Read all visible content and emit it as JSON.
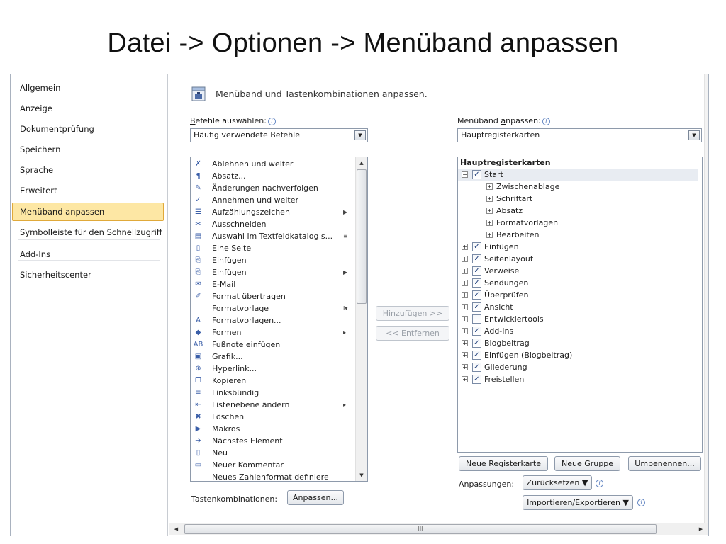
{
  "slide": {
    "title": "Datei -> Optionen -> Menüband anpassen"
  },
  "nav": {
    "items": [
      {
        "label": "Allgemein",
        "name": "nav-item-allgemein",
        "active": false
      },
      {
        "label": "Anzeige",
        "name": "nav-item-anzeige",
        "active": false
      },
      {
        "label": "Dokumentprüfung",
        "name": "nav-item-dokumentpruefung",
        "active": false
      },
      {
        "label": "Speichern",
        "name": "nav-item-speichern",
        "active": false
      },
      {
        "label": "Sprache",
        "name": "nav-item-sprache",
        "active": false
      },
      {
        "label": "Erweitert",
        "name": "nav-item-erweitert",
        "active": false
      },
      {
        "label": "Menüband anpassen",
        "name": "nav-item-menueband-anpassen",
        "active": true
      },
      {
        "label": "Symbolleiste für den Schnellzugriff",
        "name": "nav-item-schnellzugriff",
        "active": false
      },
      {
        "label": "Add-Ins",
        "name": "nav-item-add-ins",
        "active": false
      },
      {
        "label": "Sicherheitscenter",
        "name": "nav-item-sicherheitscenter",
        "active": false
      }
    ]
  },
  "content": {
    "header": "Menüband und Tastenkombinationen anpassen.",
    "commands": {
      "label_pre": "",
      "label_key": "B",
      "label_post": "efehle auswählen:",
      "selected": "Häufig verwendete Befehle",
      "items": [
        {
          "label": "Ablehnen und weiter",
          "icon": "reject-icon",
          "glyph": "✗",
          "sub": ""
        },
        {
          "label": "Absatz...",
          "icon": "paragraph-icon",
          "glyph": "¶",
          "sub": ""
        },
        {
          "label": "Änderungen nachverfolgen",
          "icon": "track-changes-icon",
          "glyph": "✎",
          "sub": ""
        },
        {
          "label": "Annehmen und weiter",
          "icon": "accept-icon",
          "glyph": "✓",
          "sub": ""
        },
        {
          "label": "Aufzählungszeichen",
          "icon": "bullets-icon",
          "glyph": "☰",
          "sub": "▶"
        },
        {
          "label": "Ausschneiden",
          "icon": "scissors-icon",
          "glyph": "✂",
          "sub": ""
        },
        {
          "label": "Auswahl im Textfeldkatalog s...",
          "icon": "textbox-icon",
          "glyph": "▤",
          "sub": "≡"
        },
        {
          "label": "Eine Seite",
          "icon": "one-page-icon",
          "glyph": "▯",
          "sub": ""
        },
        {
          "label": "Einfügen",
          "icon": "paste-icon",
          "glyph": "⎘",
          "sub": ""
        },
        {
          "label": "Einfügen",
          "icon": "paste-icon",
          "glyph": "⎘",
          "sub": "▶"
        },
        {
          "label": "E-Mail",
          "icon": "email-icon",
          "glyph": "✉",
          "sub": ""
        },
        {
          "label": "Format übertragen",
          "icon": "format-painter-icon",
          "glyph": "✐",
          "sub": ""
        },
        {
          "label": "Formatvorlage",
          "icon": "",
          "glyph": "",
          "sub": "I▾"
        },
        {
          "label": "Formatvorlagen...",
          "icon": "styles-icon",
          "glyph": "A",
          "sub": ""
        },
        {
          "label": "Formen",
          "icon": "shapes-icon",
          "glyph": "◆",
          "sub": "▸"
        },
        {
          "label": "Fußnote einfügen",
          "icon": "footnote-icon",
          "glyph": "AB",
          "sub": ""
        },
        {
          "label": "Grafik...",
          "icon": "picture-icon",
          "glyph": "▣",
          "sub": ""
        },
        {
          "label": "Hyperlink...",
          "icon": "hyperlink-icon",
          "glyph": "⊕",
          "sub": ""
        },
        {
          "label": "Kopieren",
          "icon": "copy-icon",
          "glyph": "❐",
          "sub": ""
        },
        {
          "label": "Linksbündig",
          "icon": "align-left-icon",
          "glyph": "≡",
          "sub": ""
        },
        {
          "label": "Listenebene ändern",
          "icon": "list-level-icon",
          "glyph": "⇤",
          "sub": "▸"
        },
        {
          "label": "Löschen",
          "icon": "delete-icon",
          "glyph": "✖",
          "sub": ""
        },
        {
          "label": "Makros",
          "icon": "macros-icon",
          "glyph": "▶",
          "sub": ""
        },
        {
          "label": "Nächstes Element",
          "icon": "next-item-icon",
          "glyph": "➔",
          "sub": ""
        },
        {
          "label": "Neu",
          "icon": "new-document-icon",
          "glyph": "▯",
          "sub": ""
        },
        {
          "label": "Neuer Kommentar",
          "icon": "comment-icon",
          "glyph": "▭",
          "sub": ""
        },
        {
          "label": "Neues Zahlenformat definiere",
          "icon": "",
          "glyph": "",
          "sub": ""
        }
      ]
    },
    "middle": {
      "add_label": "Hinzufügen >>",
      "remove_label": "<< Entfernen"
    },
    "ribbon": {
      "label_pre": "Menüband ",
      "label_key": "a",
      "label_post": "npassen:",
      "selected": "Hauptregisterkarten",
      "tree_header": "Hauptregisterkarten",
      "rows": [
        {
          "label": "Start",
          "level": 0,
          "expander": "⊟",
          "checked": true,
          "selected": true
        },
        {
          "label": "Zwischenablage",
          "level": 1,
          "expander": "⊞",
          "checked": null,
          "selected": false
        },
        {
          "label": "Schriftart",
          "level": 1,
          "expander": "⊞",
          "checked": null,
          "selected": false
        },
        {
          "label": "Absatz",
          "level": 1,
          "expander": "⊞",
          "checked": null,
          "selected": false
        },
        {
          "label": "Formatvorlagen",
          "level": 1,
          "expander": "⊞",
          "checked": null,
          "selected": false
        },
        {
          "label": "Bearbeiten",
          "level": 1,
          "expander": "⊞",
          "checked": null,
          "selected": false
        },
        {
          "label": "Einfügen",
          "level": 0,
          "expander": "⊞",
          "checked": true,
          "selected": false
        },
        {
          "label": "Seitenlayout",
          "level": 0,
          "expander": "⊞",
          "checked": true,
          "selected": false
        },
        {
          "label": "Verweise",
          "level": 0,
          "expander": "⊞",
          "checked": true,
          "selected": false
        },
        {
          "label": "Sendungen",
          "level": 0,
          "expander": "⊞",
          "checked": true,
          "selected": false
        },
        {
          "label": "Überprüfen",
          "level": 0,
          "expander": "⊞",
          "checked": true,
          "selected": false
        },
        {
          "label": "Ansicht",
          "level": 0,
          "expander": "⊞",
          "checked": true,
          "selected": false
        },
        {
          "label": "Entwicklertools",
          "level": 0,
          "expander": "⊞",
          "checked": false,
          "selected": false
        },
        {
          "label": "Add-Ins",
          "level": 0,
          "expander": "⊞",
          "checked": true,
          "selected": false
        },
        {
          "label": "Blogbeitrag",
          "level": 0,
          "expander": "⊞",
          "checked": true,
          "selected": false
        },
        {
          "label": "Einfügen (Blogbeitrag)",
          "level": 0,
          "expander": "⊞",
          "checked": true,
          "selected": false
        },
        {
          "label": "Gliederung",
          "level": 0,
          "expander": "⊞",
          "checked": true,
          "selected": false
        },
        {
          "label": "Freistellen",
          "level": 0,
          "expander": "⊞",
          "checked": true,
          "selected": false
        }
      ]
    },
    "buttons": {
      "new_tab": "Neue Registerkarte",
      "new_group": "Neue Gruppe",
      "rename": "Umbenennen..."
    },
    "anpassungen": {
      "label": "Anpassungen:",
      "reset": "Zurücksetzen ▼",
      "import_export": "Importieren/Exportieren ▼"
    },
    "shortcuts": {
      "label": "Tastenkombinationen:",
      "button": "Anpassen..."
    },
    "hscroll_grip": "III"
  }
}
